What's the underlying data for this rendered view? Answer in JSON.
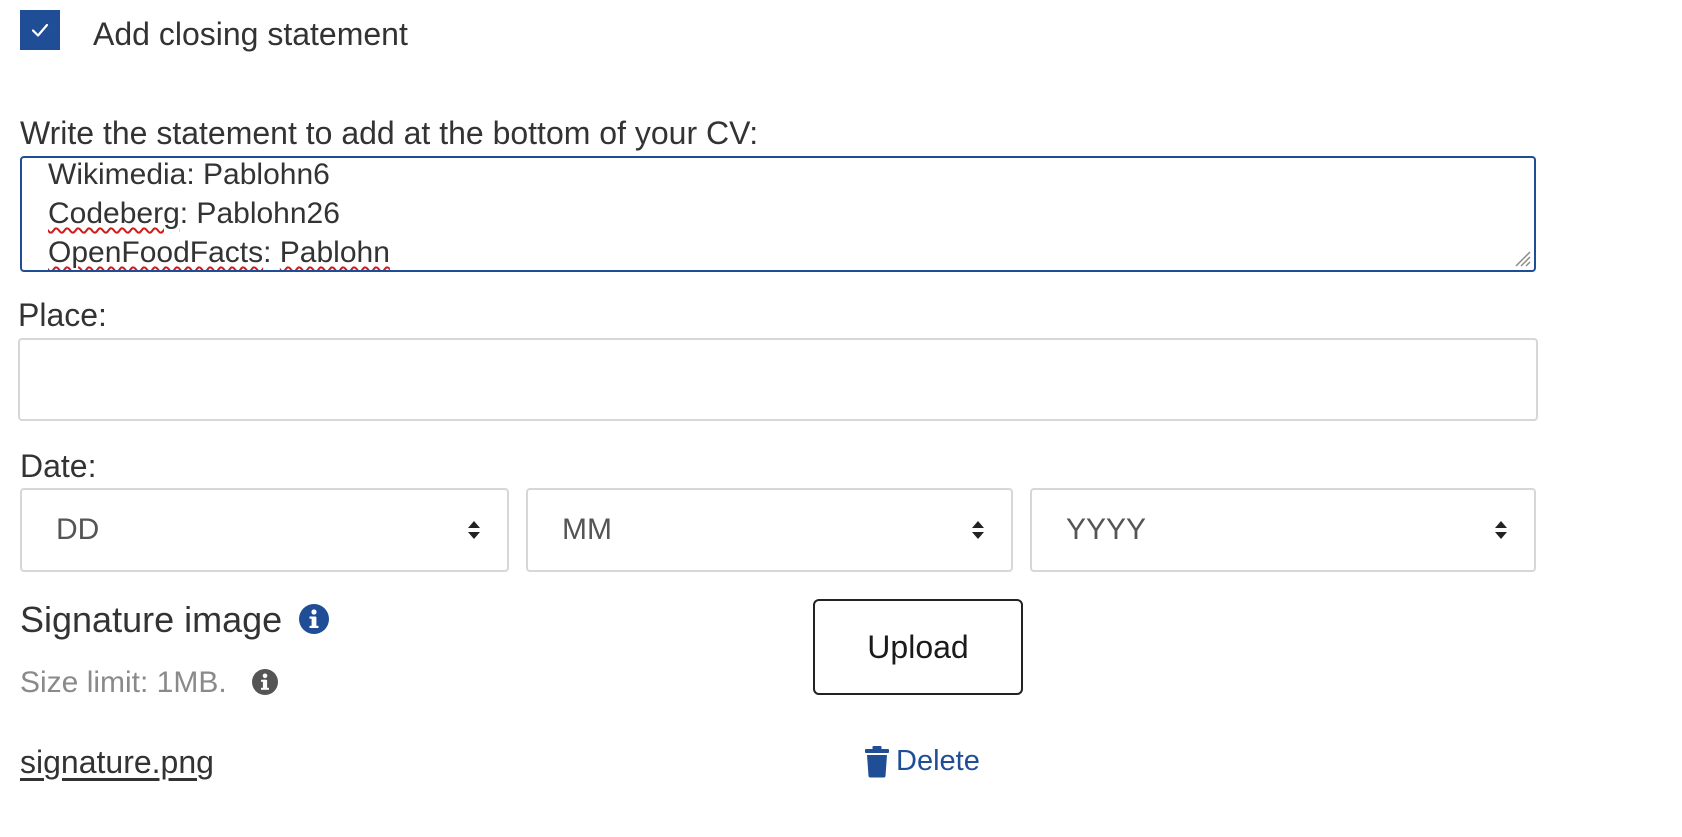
{
  "closing_statement": {
    "checkbox_checked": true,
    "checkbox_label": "Add closing statement",
    "statement_label": "Write the statement to add at the bottom of your CV:",
    "statement_lines": [
      {
        "before": "Wikimedia: Pablohn6",
        "misspelled": "",
        "after": ""
      },
      {
        "before": "",
        "misspelled": "Codeberg",
        "after": ": Pablohn26"
      },
      {
        "before": "",
        "misspelled": "OpenFoodFacts",
        "mid": ": ",
        "misspelled2": "Pablohn"
      }
    ]
  },
  "place": {
    "label": "Place:",
    "value": ""
  },
  "date": {
    "label": "Date:",
    "day_placeholder": "DD",
    "month_placeholder": "MM",
    "year_placeholder": "YYYY"
  },
  "signature": {
    "heading": "Signature image",
    "size_limit": "Size limit: 1MB.",
    "upload_label": "Upload",
    "file_name": "signature.png",
    "delete_label": "Delete"
  },
  "colors": {
    "accent": "#1f4e96",
    "text": "#333333",
    "muted": "#8a8a8a",
    "border": "#d7d7d7",
    "spellcheck": "#d11a1a"
  },
  "icons": {
    "checkbox": "checkmark-icon",
    "resize": "resize-grip-icon",
    "select_arrow": "sort-arrows-icon",
    "info": "info-circle-icon",
    "delete": "trash-icon"
  }
}
